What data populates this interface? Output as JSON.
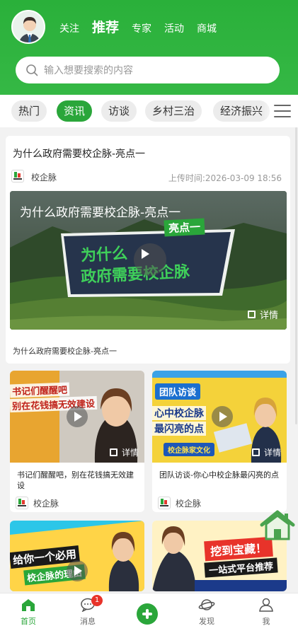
{
  "header": {
    "nav": [
      {
        "label": "关注",
        "active": false
      },
      {
        "label": "推荐",
        "active": true
      },
      {
        "label": "专家",
        "active": false
      },
      {
        "label": "活动",
        "active": false
      },
      {
        "label": "商城",
        "active": false
      }
    ],
    "search_placeholder": "输入想要搜索的内容",
    "accent_color": "#2aa63a"
  },
  "categories": [
    {
      "label": "热门",
      "active": false
    },
    {
      "label": "资讯",
      "active": true
    },
    {
      "label": "访谈",
      "active": false
    },
    {
      "label": "乡村三治",
      "active": false
    },
    {
      "label": "经济振兴",
      "active": false
    }
  ],
  "main_card": {
    "title": "为什么政府需要校企脉-亮点一",
    "source": "校企脉",
    "upload_time": "上传时间:2026-03-09 18:56",
    "video_heading": "为什么政府需要校企脉-亮点一",
    "video_tag": "亮点一",
    "video_big_line1": "为什么",
    "video_big_line2": "政府需要校企脉",
    "detail_label": "详情",
    "caption": "为什么政府需要校企脉-亮点一"
  },
  "grid": [
    {
      "title": "书记们醒醒吧，别在花钱搞无效建设",
      "source": "校企脉",
      "thumb_line1": "书记们醒醒吧",
      "thumb_line2": "别在花钱搞无效建设",
      "detail_label": "详情"
    },
    {
      "title": "团队访谈-你心中校企脉最闪亮的点",
      "source": "校企脉",
      "thumb_badge": "团队访谈",
      "thumb_line1": "心中校企脉",
      "thumb_line2": "最闪亮的点",
      "thumb_tag": "校企脉家文化",
      "detail_label": "详情"
    },
    {
      "thumb_line1": "给你一个必用",
      "thumb_line2": "校企脉的理由"
    },
    {
      "thumb_line1": "挖到宝藏！",
      "thumb_line2": "一站式平台推荐"
    }
  ],
  "tabbar": [
    {
      "label": "首页",
      "icon": "home-icon",
      "active": true
    },
    {
      "label": "消息",
      "icon": "message-icon",
      "active": false,
      "badge": "1"
    },
    {
      "label": "发现",
      "icon": "planet-icon",
      "active": false
    },
    {
      "label": "我",
      "icon": "user-icon",
      "active": false
    }
  ]
}
